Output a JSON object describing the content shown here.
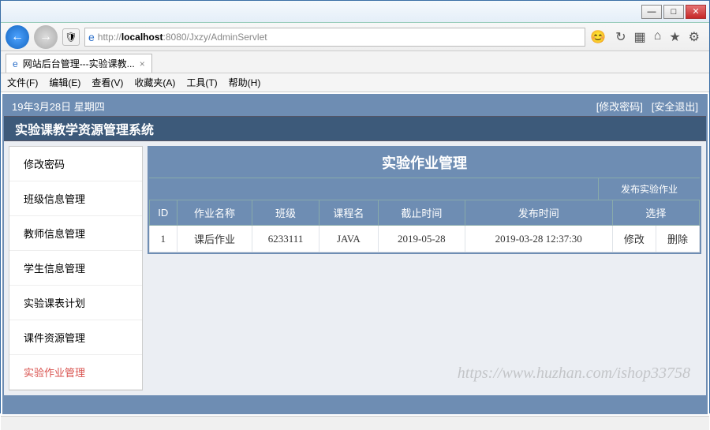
{
  "window": {
    "min": "—",
    "max": "□",
    "close": "✕"
  },
  "address": {
    "proto": "http://",
    "host": "localhost",
    "port": ":8080",
    "path": "/Jxzy/AdminServlet"
  },
  "tab": {
    "title": "网站后台管理---实验课教...",
    "close": "×"
  },
  "menubar": {
    "file": "文件(F)",
    "edit": "编辑(E)",
    "view": "查看(V)",
    "fav": "收藏夹(A)",
    "tools": "工具(T)",
    "help": "帮助(H)"
  },
  "topbar": {
    "date": "19年3月28日 星期四",
    "changePwd": "[修改密码]",
    "logout": "[安全退出]"
  },
  "system": {
    "title": "实验课教学资源管理系统"
  },
  "sidebar": {
    "items": [
      {
        "label": "修改密码"
      },
      {
        "label": "班级信息管理"
      },
      {
        "label": "教师信息管理"
      },
      {
        "label": "学生信息管理"
      },
      {
        "label": "实验课表计划"
      },
      {
        "label": "课件资源管理"
      },
      {
        "label": "实验作业管理"
      }
    ]
  },
  "panel": {
    "title": "实验作业管理",
    "publish": "发布实验作业",
    "headers": {
      "id": "ID",
      "name": "作业名称",
      "class": "班级",
      "course": "课程名",
      "deadline": "截止时间",
      "pubtime": "发布时间",
      "select": "选择"
    },
    "rows": [
      {
        "id": "1",
        "name": "课后作业",
        "class": "6233111",
        "course": "JAVA",
        "deadline": "2019-05-28",
        "pubtime": "2019-03-28 12:37:30",
        "edit": "修改",
        "del": "删除"
      }
    ]
  },
  "watermark": "https://www.huzhan.com/ishop33758"
}
